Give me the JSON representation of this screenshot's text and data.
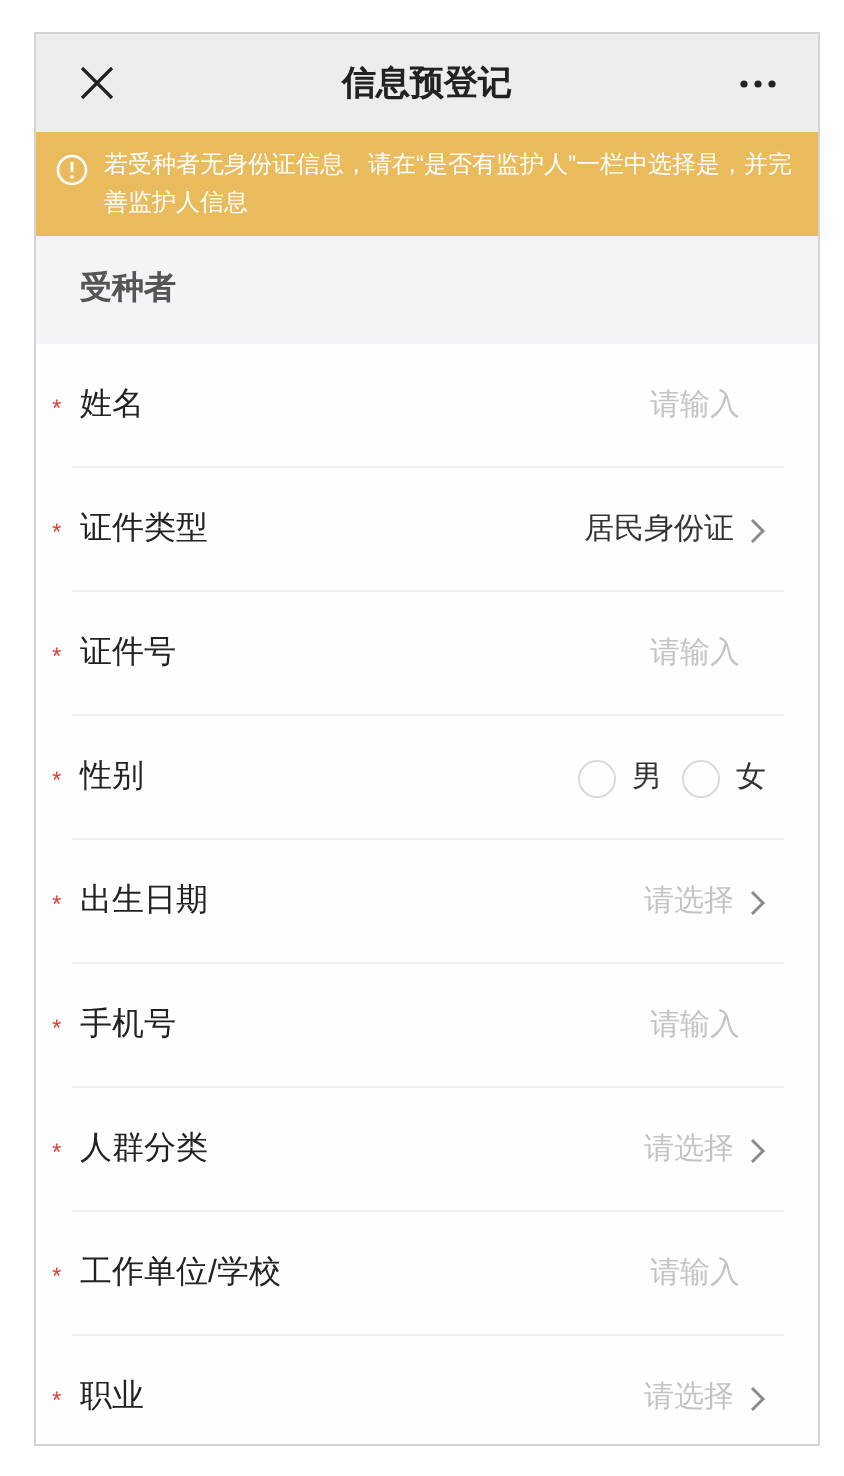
{
  "nav": {
    "title": "信息预登记"
  },
  "notice": {
    "text": "若受种者无身份证信息，请在“是否有监护人”一栏中选择是，并完善监护人信息"
  },
  "section": {
    "title": "受种者"
  },
  "fields": [
    {
      "kind": "input",
      "required_mark": "*",
      "label": "姓名",
      "placeholder": "请输入"
    },
    {
      "kind": "select",
      "required_mark": "*",
      "label": "证件类型",
      "value": "居民身份证"
    },
    {
      "kind": "input",
      "required_mark": "*",
      "label": "证件号",
      "placeholder": "请输入"
    },
    {
      "kind": "radio",
      "required_mark": "*",
      "label": "性别",
      "options": [
        {
          "label": "男",
          "selected": false
        },
        {
          "label": "女",
          "selected": false
        }
      ]
    },
    {
      "kind": "select",
      "required_mark": "*",
      "label": "出生日期",
      "placeholder": "请选择"
    },
    {
      "kind": "input",
      "required_mark": "*",
      "label": "手机号",
      "placeholder": "请输入"
    },
    {
      "kind": "select",
      "required_mark": "*",
      "label": "人群分类",
      "placeholder": "请选择"
    },
    {
      "kind": "input",
      "required_mark": "*",
      "label": "工作单位/学校",
      "placeholder": "请输入"
    },
    {
      "kind": "select",
      "required_mark": "*",
      "label": "职业",
      "placeholder": "请选择"
    }
  ]
}
